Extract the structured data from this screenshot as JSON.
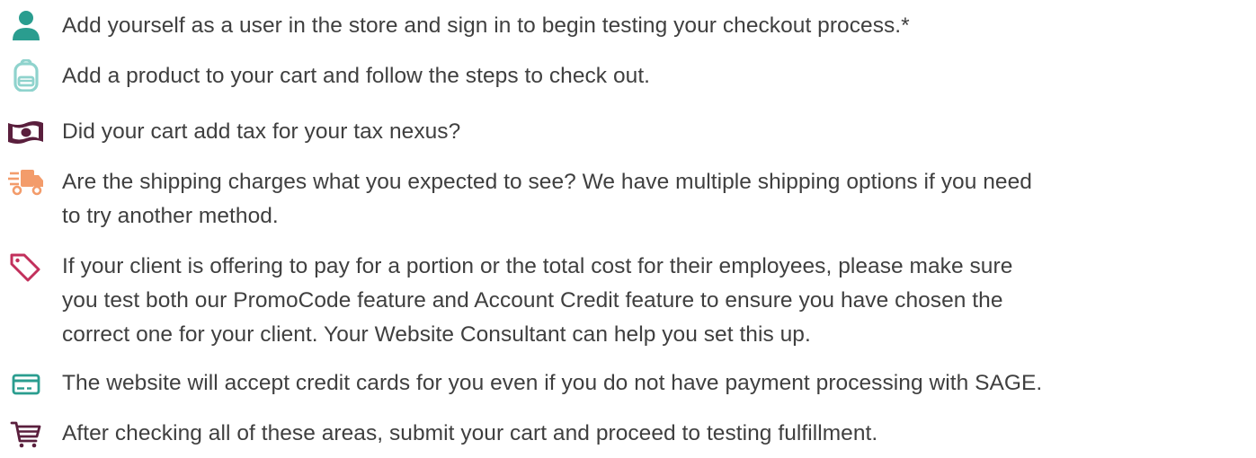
{
  "checklist": {
    "items": [
      {
        "icon": "user-icon",
        "color": "#2a9d8f",
        "text": "Add yourself as a user in the store and sign in to begin testing your checkout process.*"
      },
      {
        "icon": "backpack-icon",
        "color": "#8fd3cd",
        "text": "Add a product to your cart and follow the steps to check out."
      },
      {
        "icon": "money-icon",
        "color": "#5a1f3d",
        "text": "Did your cart add tax for your tax nexus?"
      },
      {
        "icon": "shipping-truck-icon",
        "color": "#f39c6b",
        "lines": [
          "Are the shipping charges what you expected to see? We have multiple shipping options if you need",
          "to try another method."
        ]
      },
      {
        "icon": "price-tag-icon",
        "color": "#c2305c",
        "lines": [
          "If your client is offering to pay for a portion or the total cost for their employees, please make sure",
          "you test both our PromoCode feature and Account Credit feature to ensure you have chosen the",
          "correct one for your client. Your Website Consultant can help you set this up."
        ]
      },
      {
        "icon": "credit-card-icon",
        "color": "#2a9d8f",
        "text": "The website will accept credit cards for you even if you do not have payment processing with SAGE."
      },
      {
        "icon": "shopping-cart-icon",
        "color": "#5a1f3d",
        "text": "After checking all of these areas, submit your cart and proceed to testing fulfillment."
      }
    ]
  }
}
